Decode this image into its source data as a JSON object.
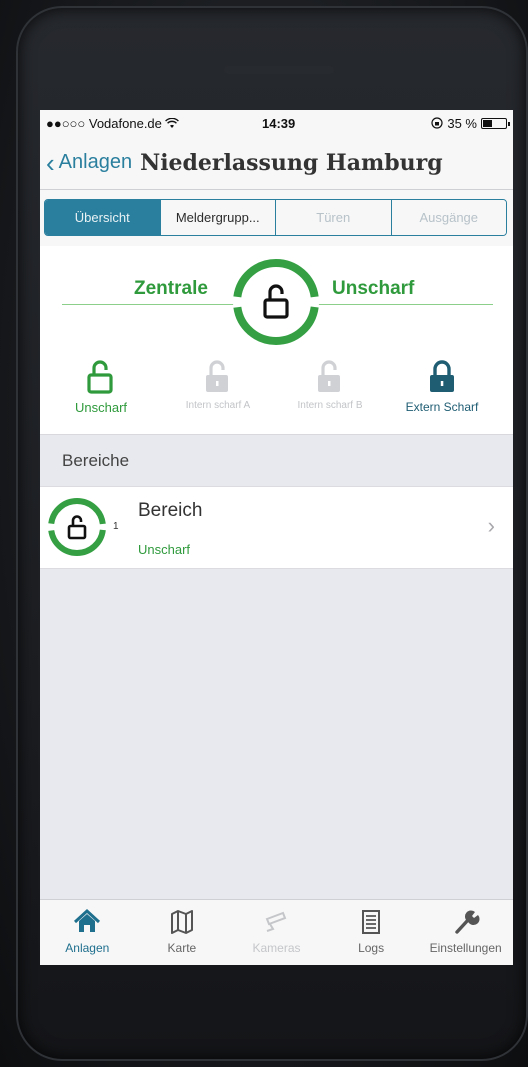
{
  "colors": {
    "accent": "#2a7f9e",
    "armed_green": "#2f9a3c",
    "extern_teal": "#1f5d73",
    "disabled": "#c2c4c7"
  },
  "statusbar": {
    "carrier": "●●○○○ Vodafone.de",
    "wifi_icon": "wifi-icon",
    "time": "14:39",
    "battery_text": "35 %"
  },
  "navbar": {
    "back_label": "Anlagen",
    "title": "Niederlassung Hamburg"
  },
  "tabs": [
    {
      "label": "Übersicht",
      "active": true
    },
    {
      "label": "Meldergrupp...",
      "active": false
    },
    {
      "label": "Türen",
      "active": false
    },
    {
      "label": "Ausgänge",
      "active": false
    }
  ],
  "zentrale": {
    "label": "Zentrale",
    "state": "Unscharf"
  },
  "modes": [
    {
      "label": "Unscharf",
      "icon": "unlocked-icon",
      "state": "active"
    },
    {
      "label": "Intern scharf A",
      "icon": "unlocked-icon",
      "state": "disabled"
    },
    {
      "label": "Intern scharf B",
      "icon": "unlocked-icon",
      "state": "disabled"
    },
    {
      "label": "Extern Scharf",
      "icon": "locked-icon",
      "state": "available"
    }
  ],
  "section": {
    "title": "Bereiche"
  },
  "bereiche": [
    {
      "number": "1",
      "name": "Bereich",
      "state": "Unscharf"
    }
  ],
  "tabbar": [
    {
      "label": "Anlagen",
      "icon": "home-icon",
      "state": "active"
    },
    {
      "label": "Karte",
      "icon": "map-icon",
      "state": "normal"
    },
    {
      "label": "Kameras",
      "icon": "camera-icon",
      "state": "disabled"
    },
    {
      "label": "Logs",
      "icon": "list-icon",
      "state": "normal"
    },
    {
      "label": "Einstellungen",
      "icon": "wrench-icon",
      "state": "normal"
    }
  ]
}
